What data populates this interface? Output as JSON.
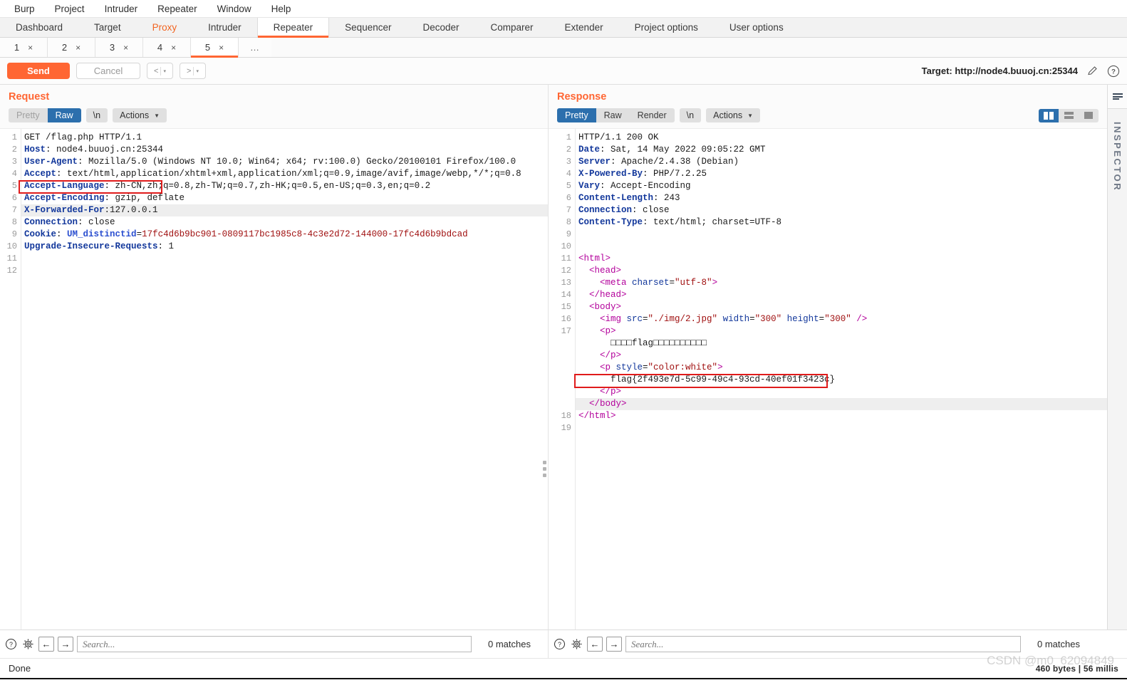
{
  "menubar": [
    "Burp",
    "Project",
    "Intruder",
    "Repeater",
    "Window",
    "Help"
  ],
  "main_tabs": [
    {
      "label": "Dashboard",
      "state": "normal"
    },
    {
      "label": "Target",
      "state": "normal"
    },
    {
      "label": "Proxy",
      "state": "accent"
    },
    {
      "label": "Intruder",
      "state": "normal"
    },
    {
      "label": "Repeater",
      "state": "active"
    },
    {
      "label": "Sequencer",
      "state": "normal"
    },
    {
      "label": "Decoder",
      "state": "normal"
    },
    {
      "label": "Comparer",
      "state": "normal"
    },
    {
      "label": "Extender",
      "state": "normal"
    },
    {
      "label": "Project options",
      "state": "normal"
    },
    {
      "label": "User options",
      "state": "normal"
    }
  ],
  "repeater_tabs": [
    {
      "label": "1",
      "close": "×",
      "active": false
    },
    {
      "label": "2",
      "close": "×",
      "active": false
    },
    {
      "label": "3",
      "close": "×",
      "active": false
    },
    {
      "label": "4",
      "close": "×",
      "active": false
    },
    {
      "label": "5",
      "close": "×",
      "active": true
    }
  ],
  "repeater_tabs_more": "…",
  "toolbar": {
    "send_label": "Send",
    "cancel_label": "Cancel",
    "back_label": "<",
    "forward_label": ">",
    "caret": "▾",
    "target_label": "Target: http://node4.buuoj.cn:25344",
    "edit_icon": "✎",
    "help_icon": "?"
  },
  "request": {
    "title": "Request",
    "modes": [
      {
        "label": "Pretty",
        "selected": false,
        "dim": true
      },
      {
        "label": "Raw",
        "selected": true,
        "dim": false
      }
    ],
    "newline_label": "\\n",
    "actions_label": "Actions",
    "lines": [
      {
        "n": "1",
        "segs": [
          {
            "t": "GET /flag.php HTTP/1.1",
            "c": "plain"
          }
        ]
      },
      {
        "n": "2",
        "segs": [
          {
            "t": "Host",
            "c": "hdr-name"
          },
          {
            "t": ": node4.buuoj.cn:25344",
            "c": "hdr-val"
          }
        ]
      },
      {
        "n": "3",
        "segs": [
          {
            "t": "User-Agent",
            "c": "hdr-name"
          },
          {
            "t": ": Mozilla/5.0 (Windows NT 10.0; Win64; x64; rv:100.0) Gecko/20100101 Firefox/100.0",
            "c": "hdr-val"
          }
        ]
      },
      {
        "n": "4",
        "segs": [
          {
            "t": "Accept",
            "c": "hdr-name"
          },
          {
            "t": ": text/html,application/xhtml+xml,application/xml;q=0.9,image/avif,image/webp,*/*;q=0.8",
            "c": "hdr-val"
          }
        ]
      },
      {
        "n": "5",
        "segs": [
          {
            "t": "Accept-Language",
            "c": "hdr-name"
          },
          {
            "t": ": zh-CN,zh;q=0.8,zh-TW;q=0.7,zh-HK;q=0.5,en-US;q=0.3,en;q=0.2",
            "c": "hdr-val"
          }
        ]
      },
      {
        "n": "6",
        "segs": [
          {
            "t": "Accept-Encoding",
            "c": "hdr-name"
          },
          {
            "t": ": gzip, deflate",
            "c": "hdr-val"
          }
        ]
      },
      {
        "n": "7",
        "segs": [
          {
            "t": "X-Forwarded-For",
            "c": "hdr-name"
          },
          {
            "t": ":127.0.0.1",
            "c": "hdr-val"
          }
        ],
        "highlight": true
      },
      {
        "n": "8",
        "segs": [
          {
            "t": "Connection",
            "c": "hdr-name"
          },
          {
            "t": ": close",
            "c": "hdr-val"
          }
        ]
      },
      {
        "n": "9",
        "segs": [
          {
            "t": "Cookie",
            "c": "hdr-name"
          },
          {
            "t": ": ",
            "c": "hdr-val"
          },
          {
            "t": "UM_distinctid",
            "c": "cookie-name"
          },
          {
            "t": "=",
            "c": "plain"
          },
          {
            "t": "17fc4d6b9bc901-0809117bc1985c8-4c3e2d72-144000-17fc4d6b9bdcad",
            "c": "cookie-val"
          }
        ]
      },
      {
        "n": "10",
        "segs": [
          {
            "t": "Upgrade-Insecure-Requests",
            "c": "hdr-name"
          },
          {
            "t": ": 1",
            "c": "hdr-val"
          }
        ]
      },
      {
        "n": "11",
        "segs": []
      },
      {
        "n": "12",
        "segs": []
      }
    ]
  },
  "response": {
    "title": "Response",
    "modes": [
      {
        "label": "Pretty",
        "selected": true,
        "dim": false
      },
      {
        "label": "Raw",
        "selected": false,
        "dim": false
      },
      {
        "label": "Render",
        "selected": false,
        "dim": false
      }
    ],
    "newline_label": "\\n",
    "actions_label": "Actions",
    "view_modes": [
      "split-view-icon",
      "stacked-view-icon",
      "single-view-icon"
    ],
    "lines": [
      {
        "n": "1",
        "segs": [
          {
            "t": "HTTP/1.1 200 OK",
            "c": "plain"
          }
        ]
      },
      {
        "n": "2",
        "segs": [
          {
            "t": "Date",
            "c": "hdr-name"
          },
          {
            "t": ": Sat, 14 May 2022 09:05:22 GMT",
            "c": "hdr-val"
          }
        ]
      },
      {
        "n": "3",
        "segs": [
          {
            "t": "Server",
            "c": "hdr-name"
          },
          {
            "t": ": Apache/2.4.38 (Debian)",
            "c": "hdr-val"
          }
        ]
      },
      {
        "n": "4",
        "segs": [
          {
            "t": "X-Powered-By",
            "c": "hdr-name"
          },
          {
            "t": ": PHP/7.2.25",
            "c": "hdr-val"
          }
        ]
      },
      {
        "n": "5",
        "segs": [
          {
            "t": "Vary",
            "c": "hdr-name"
          },
          {
            "t": ": Accept-Encoding",
            "c": "hdr-val"
          }
        ]
      },
      {
        "n": "6",
        "segs": [
          {
            "t": "Content-Length",
            "c": "hdr-name"
          },
          {
            "t": ": 243",
            "c": "hdr-val"
          }
        ]
      },
      {
        "n": "7",
        "segs": [
          {
            "t": "Connection",
            "c": "hdr-name"
          },
          {
            "t": ": close",
            "c": "hdr-val"
          }
        ]
      },
      {
        "n": "8",
        "segs": [
          {
            "t": "Content-Type",
            "c": "hdr-name"
          },
          {
            "t": ": text/html; charset=UTF-8",
            "c": "hdr-val"
          }
        ]
      },
      {
        "n": "9",
        "segs": []
      },
      {
        "n": "10",
        "segs": []
      },
      {
        "n": "11",
        "segs": [
          {
            "t": "<html>",
            "c": "tag"
          }
        ]
      },
      {
        "n": "12",
        "segs": [
          {
            "t": "  <head>",
            "c": "tag"
          }
        ]
      },
      {
        "n": "13",
        "segs": [
          {
            "t": "    <meta ",
            "c": "tag"
          },
          {
            "t": "charset",
            "c": "attr"
          },
          {
            "t": "=",
            "c": "plain"
          },
          {
            "t": "\"utf-8\"",
            "c": "attrv"
          },
          {
            "t": ">",
            "c": "tag"
          }
        ]
      },
      {
        "n": "14",
        "segs": [
          {
            "t": "  </head>",
            "c": "tag"
          }
        ]
      },
      {
        "n": "15",
        "segs": [
          {
            "t": "  <body>",
            "c": "tag"
          }
        ]
      },
      {
        "n": "16",
        "segs": [
          {
            "t": "    <img ",
            "c": "tag"
          },
          {
            "t": "src",
            "c": "attr"
          },
          {
            "t": "=",
            "c": "plain"
          },
          {
            "t": "\"./img/2.jpg\"",
            "c": "attrv"
          },
          {
            "t": " ",
            "c": "plain"
          },
          {
            "t": "width",
            "c": "attr"
          },
          {
            "t": "=",
            "c": "plain"
          },
          {
            "t": "\"300\"",
            "c": "attrv"
          },
          {
            "t": " ",
            "c": "plain"
          },
          {
            "t": "height",
            "c": "attr"
          },
          {
            "t": "=",
            "c": "plain"
          },
          {
            "t": "\"300\"",
            "c": "attrv"
          },
          {
            "t": " />",
            "c": "tag"
          }
        ]
      },
      {
        "n": "17",
        "segs": [
          {
            "t": "    <p>",
            "c": "tag"
          }
        ]
      },
      {
        "n": "",
        "segs": [
          {
            "t": "      □□□□flag□□□□□□□□□□",
            "c": "plain"
          }
        ]
      },
      {
        "n": "",
        "segs": [
          {
            "t": "    </p>",
            "c": "tag"
          }
        ]
      },
      {
        "n": "",
        "segs": [
          {
            "t": "    <p ",
            "c": "tag"
          },
          {
            "t": "style",
            "c": "attr"
          },
          {
            "t": "=",
            "c": "plain"
          },
          {
            "t": "\"color:white\"",
            "c": "attrv"
          },
          {
            "t": ">",
            "c": "tag"
          }
        ]
      },
      {
        "n": "",
        "segs": [
          {
            "t": "      flag{2f493e7d-5c99-49c4-93cd-40ef01f3423c}",
            "c": "plain"
          }
        ]
      },
      {
        "n": "",
        "segs": [
          {
            "t": "    </p>",
            "c": "tag"
          }
        ]
      },
      {
        "n": "",
        "segs": [
          {
            "t": "  </body>",
            "c": "tag"
          }
        ],
        "highlight": true
      },
      {
        "n": "18",
        "segs": [
          {
            "t": "</html>",
            "c": "tag"
          }
        ]
      },
      {
        "n": "19",
        "segs": []
      }
    ]
  },
  "inspector": {
    "label": "INSPECTOR",
    "toggle_icon": "collapse-icon"
  },
  "search": {
    "help_icon": "?",
    "settings_icon": "gear-icon",
    "prev_icon": "←",
    "next_icon": "→",
    "placeholder": "Search...",
    "value": "",
    "matches_left": "0 matches",
    "matches_right": "0 matches"
  },
  "statusbar": {
    "text": "Done",
    "right_text": "460 bytes | 56 millis",
    "watermark": "CSDN @m0_62094849"
  }
}
